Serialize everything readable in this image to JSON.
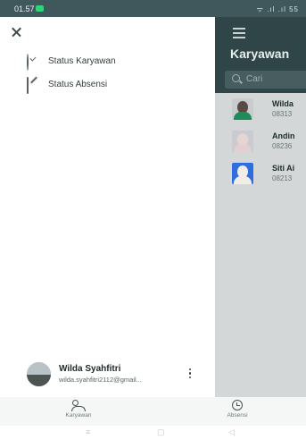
{
  "status_bar": {
    "time": "01.57",
    "indicators": "ᯤ .ıl .ıl 55"
  },
  "background_app": {
    "title": "Karyawan",
    "search_placeholder": "Cari",
    "employees": [
      {
        "name": "Wilda",
        "phone": "08313",
        "scarf_color": "#1f8a5a"
      },
      {
        "name": "Andin",
        "phone": "08236",
        "scarf_color": "#e3cfd1"
      },
      {
        "name": "Siti Ai",
        "phone": "08213",
        "scarf_color": "#2f6de0"
      }
    ]
  },
  "drawer": {
    "menu": [
      {
        "label": "Status Karyawan",
        "icon": "check-circle-icon"
      },
      {
        "label": "Status Absensi",
        "icon": "edit-icon"
      }
    ],
    "profile": {
      "name": "Wilda Syahfitri",
      "email": "wilda.syahfitri2112@gmail..."
    }
  },
  "bottom_nav": {
    "items": [
      {
        "label": "Karyawan",
        "icon": "people-icon"
      },
      {
        "label": "Absensi",
        "icon": "clock-icon"
      }
    ]
  },
  "system_nav": {
    "recents": "≡",
    "home": "▢",
    "back": "◁"
  }
}
